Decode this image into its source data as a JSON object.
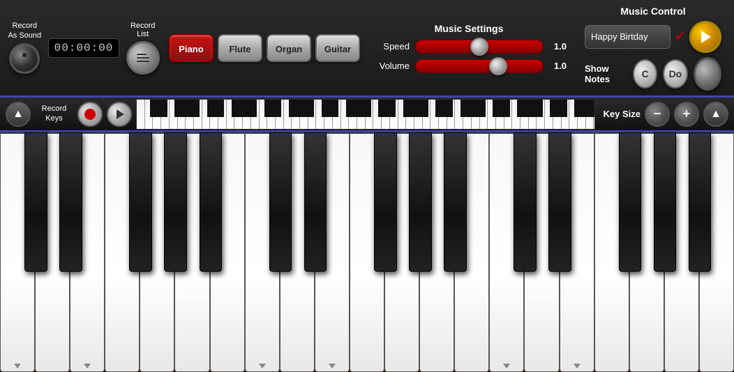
{
  "header": {
    "record_as_sound": "Record\nAs Sound",
    "record_as_sound_line1": "Record",
    "record_as_sound_line2": "As Sound",
    "timer": "00:00:00",
    "record_list": "Record\nList",
    "record_list_line1": "Record",
    "record_list_line2": "List",
    "instruments": [
      "Piano",
      "Flute",
      "Organ",
      "Guitar"
    ],
    "active_instrument": "Piano",
    "music_settings_title": "Music Settings",
    "speed_label": "Speed",
    "speed_value": "1.0",
    "volume_label": "Volume",
    "volume_value": "1.0",
    "music_control_title": "Music Control",
    "song_name": "Happy Birtday",
    "show_notes_label": "Show Notes",
    "note_c": "C",
    "note_do": "Do"
  },
  "control_row": {
    "record_keys_label": "Record\nKeys",
    "key_size_label": "Key Size"
  },
  "white_keys_count": 21,
  "black_key_positions": [
    6.5,
    11.2,
    20.5,
    25.2,
    30.0,
    39.5,
    44.2,
    53.5,
    58.2,
    63.0,
    72.5,
    77.2,
    86.5,
    91.2,
    96.0
  ]
}
